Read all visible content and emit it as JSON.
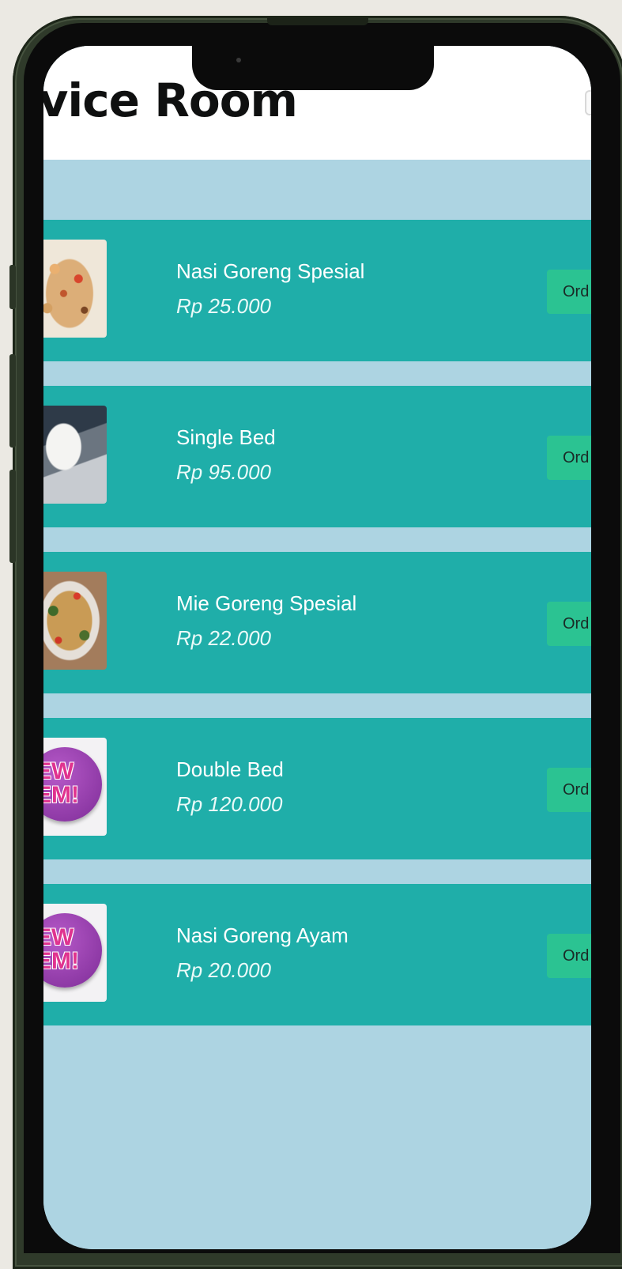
{
  "header": {
    "title": "rvice Room"
  },
  "menu_items": [
    {
      "name": "Nasi Goreng Spesial",
      "price": "Rp 25.000",
      "image": "fried-rice-photo",
      "order_label": "Ord"
    },
    {
      "name": "Single Bed",
      "price": "Rp 95.000",
      "image": "bed-photo",
      "order_label": "Ord"
    },
    {
      "name": "Mie Goreng Spesial",
      "price": "Rp 22.000",
      "image": "fried-noodle-photo",
      "order_label": "Ord"
    },
    {
      "name": "Double Bed",
      "price": "Rp 120.000",
      "image": "new-item-badge",
      "image_text": "EW\nEM!",
      "order_label": "Ord"
    },
    {
      "name": "Nasi Goreng Ayam",
      "price": "Rp 20.000",
      "image": "new-item-badge",
      "image_text": "EW\nEM!",
      "order_label": "Ord"
    }
  ],
  "colors": {
    "page_background": "#ebe9e3",
    "phone_frame": "#2f3a2a",
    "screen_background": "#add4e2",
    "card_background": "#1faea9",
    "order_button": "#2bc392",
    "title_text": "#0f1010"
  }
}
